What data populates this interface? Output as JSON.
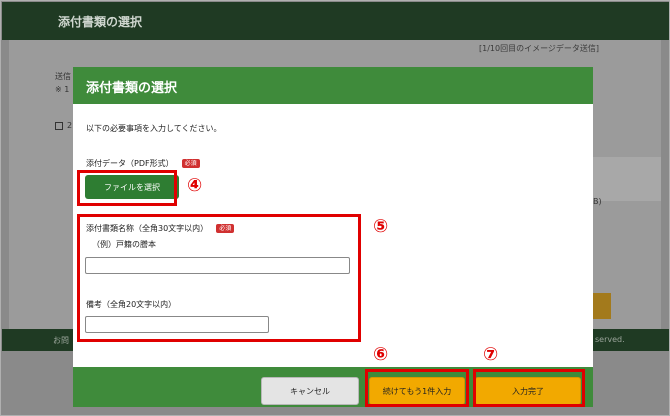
{
  "background": {
    "title": "添付書類の選択",
    "page_indicator": "[1/10回目のイメージデータ送信]",
    "text_1": "送信",
    "text_2": "※ 1",
    "text_3": "2",
    "text_4": "B)",
    "footer_left": "お問",
    "footer_right": "served."
  },
  "modal": {
    "title": "添付書類の選択",
    "instruction": "以下の必要事項を入力してください。",
    "file_label": "添付データ（PDF形式）",
    "required_badge": "必須",
    "file_button": "ファイルを選択",
    "doc_name_label": "添付書類名称（全角30文字以内）",
    "doc_name_example": "（例）戸籍の謄本",
    "doc_name_value": "",
    "remarks_label": "備考（全角20文字以内）",
    "remarks_value": "",
    "buttons": {
      "cancel": "キャンセル",
      "continue": "続けてもう1件入力",
      "complete": "入力完了"
    }
  },
  "callouts": [
    "④",
    "⑤",
    "⑥",
    "⑦"
  ],
  "colors": {
    "header_green": "#3f8b3b",
    "button_green": "#2e7d32",
    "accent_orange": "#f2a900",
    "required_red": "#d03030",
    "callout_red": "#e00000"
  }
}
